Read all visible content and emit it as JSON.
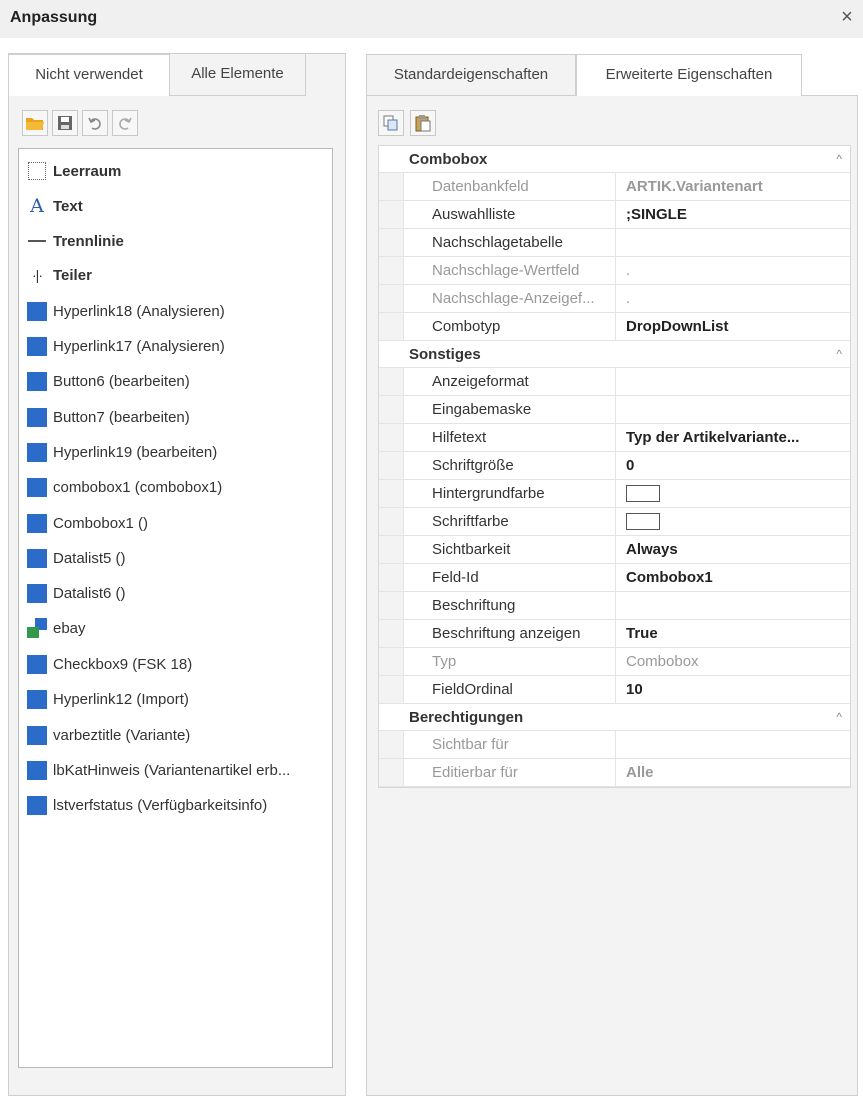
{
  "window": {
    "title": "Anpassung",
    "close_glyph": "×"
  },
  "left": {
    "tabs": [
      "Nicht verwendet",
      "Alle Elemente"
    ],
    "toolbar": [
      "open-folder-icon",
      "save-icon",
      "undo-icon",
      "redo-icon"
    ],
    "items": [
      {
        "icon": "leerraum-icon",
        "label": "Leerraum",
        "bold": true
      },
      {
        "icon": "text-icon",
        "label": "Text",
        "bold": true
      },
      {
        "icon": "trennlinie-icon",
        "label": "Trennlinie",
        "bold": true
      },
      {
        "icon": "teiler-icon",
        "label": "Teiler",
        "bold": true
      },
      {
        "icon": "control-icon",
        "label": "Hyperlink18 (Analysieren)"
      },
      {
        "icon": "control-icon",
        "label": "Hyperlink17 (Analysieren)"
      },
      {
        "icon": "control-icon",
        "label": "Button6 (bearbeiten)"
      },
      {
        "icon": "control-icon",
        "label": "Button7 (bearbeiten)"
      },
      {
        "icon": "control-icon",
        "label": "Hyperlink19 (bearbeiten)"
      },
      {
        "icon": "control-icon",
        "label": "combobox1 (combobox1)"
      },
      {
        "icon": "control-icon",
        "label": "Combobox1 ()"
      },
      {
        "icon": "control-icon",
        "label": "Datalist5 ()"
      },
      {
        "icon": "control-icon",
        "label": "Datalist6 ()"
      },
      {
        "icon": "group-icon",
        "label": "ebay"
      },
      {
        "icon": "control-icon",
        "label": "Checkbox9 (FSK 18)"
      },
      {
        "icon": "control-icon",
        "label": "Hyperlink12 (Import)"
      },
      {
        "icon": "control-icon",
        "label": "varbeztitle (Variante)"
      },
      {
        "icon": "control-icon",
        "label": "lbKatHinweis (Variantenartikel erb..."
      },
      {
        "icon": "control-icon",
        "label": "lstverfstatus (Verfügbarkeitsinfo)"
      }
    ]
  },
  "right": {
    "tabs": [
      "Standardeigenschaften",
      "Erweiterte Eigenschaften"
    ],
    "toolbar": [
      "copy-icon",
      "paste-icon"
    ],
    "sections": [
      {
        "title": "Combobox",
        "rows": [
          {
            "key": "Datenbankfeld",
            "value": "ARTIK.Variantenart",
            "bold": true,
            "disabled": true
          },
          {
            "key": "Auswahlliste",
            "value": ";SINGLE",
            "bold": true
          },
          {
            "key": "Nachschlagetabelle",
            "value": ""
          },
          {
            "key": "Nachschlage-Wertfeld",
            "value": ".",
            "disabled": true
          },
          {
            "key": "Nachschlage-Anzeigef...",
            "value": ".",
            "disabled": true
          },
          {
            "key": "Combotyp",
            "value": "DropDownList",
            "bold": true
          }
        ]
      },
      {
        "title": "Sonstiges",
        "rows": [
          {
            "key": "Anzeigeformat",
            "value": ""
          },
          {
            "key": "Eingabemaske",
            "value": ""
          },
          {
            "key": "Hilfetext",
            "value": "Typ der Artikelvariante...",
            "bold": true
          },
          {
            "key": "Schriftgröße",
            "value": "0",
            "bold": true
          },
          {
            "key": "Hintergrundfarbe",
            "value": "",
            "swatch": "#ffffff"
          },
          {
            "key": "Schriftfarbe",
            "value": "",
            "swatch": "#ffffff"
          },
          {
            "key": "Sichtbarkeit",
            "value": "Always",
            "bold": true
          },
          {
            "key": "Feld-Id",
            "value": "Combobox1",
            "bold": true
          },
          {
            "key": "Beschriftung",
            "value": ""
          },
          {
            "key": "Beschriftung anzeigen",
            "value": "True",
            "bold": true
          },
          {
            "key": "Typ",
            "value": "Combobox",
            "disabled": true
          },
          {
            "key": "FieldOrdinal",
            "value": "10",
            "bold": true
          }
        ]
      },
      {
        "title": "Berechtigungen",
        "rows": [
          {
            "key": "Sichtbar für",
            "value": "",
            "disabled": true
          },
          {
            "key": "Editierbar für",
            "value": "Alle",
            "disabled": true,
            "bold": true
          }
        ]
      }
    ]
  },
  "colors": {
    "accent": "#2b6cc8",
    "group_green": "#34984a",
    "text_blue": "#2a5eae"
  }
}
